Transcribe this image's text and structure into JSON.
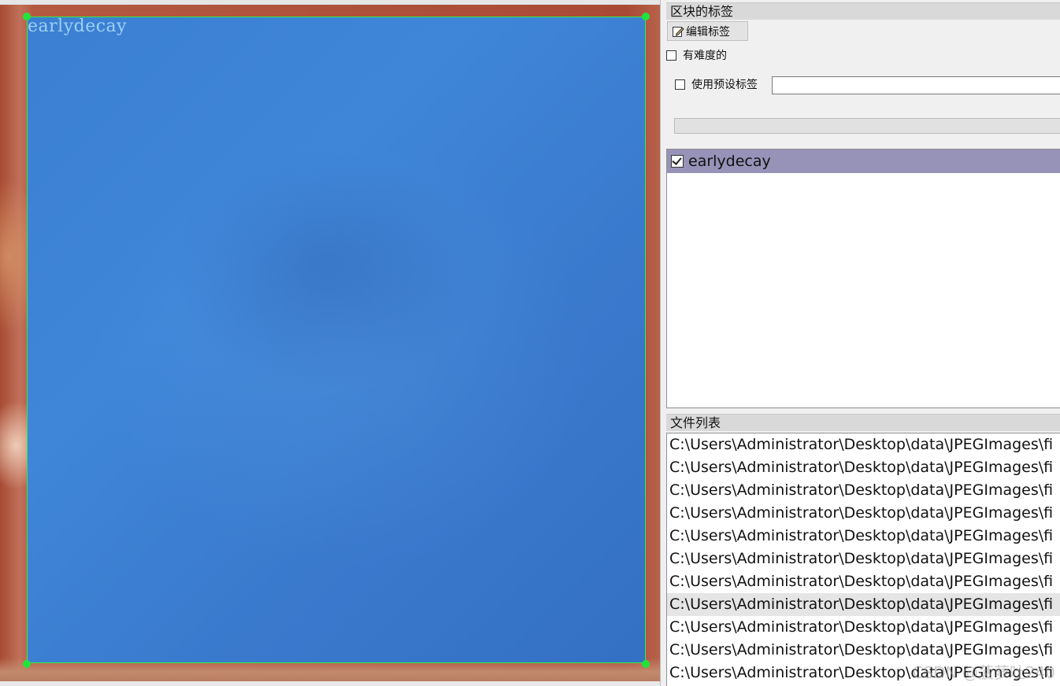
{
  "canvas": {
    "box_label": "earlydecay",
    "box_color": "#2ef04a",
    "fill_color": "#3f86d8"
  },
  "right_panel": {
    "box_labels_title": "区块的标签",
    "edit_label_button": "编辑标签",
    "difficult_checkbox": {
      "label": "有难度的",
      "checked": false
    },
    "use_preset_checkbox": {
      "label": "使用预设标签",
      "checked": false
    },
    "preset_input_value": "",
    "labels": [
      {
        "name": "earlydecay",
        "checked": true,
        "selected": true
      }
    ],
    "file_list_title": "文件列表",
    "files": [
      "C:\\Users\\Administrator\\Desktop\\data\\JPEGImages\\fi",
      "C:\\Users\\Administrator\\Desktop\\data\\JPEGImages\\fi",
      "C:\\Users\\Administrator\\Desktop\\data\\JPEGImages\\fi",
      "C:\\Users\\Administrator\\Desktop\\data\\JPEGImages\\fi",
      "C:\\Users\\Administrator\\Desktop\\data\\JPEGImages\\fi",
      "C:\\Users\\Administrator\\Desktop\\data\\JPEGImages\\fi",
      "C:\\Users\\Administrator\\Desktop\\data\\JPEGImages\\fi",
      "C:\\Users\\Administrator\\Desktop\\data\\JPEGImages\\fi",
      "C:\\Users\\Administrator\\Desktop\\data\\JPEGImages\\fi",
      "C:\\Users\\Administrator\\Desktop\\data\\JPEGImages\\fi",
      "C:\\Users\\Administrator\\Desktop\\data\\JPEGImages\\fi"
    ],
    "selected_file_index": 7,
    "label_highlight_color": "#9792b8"
  },
  "watermark": "CSDN @菠萝吐240"
}
